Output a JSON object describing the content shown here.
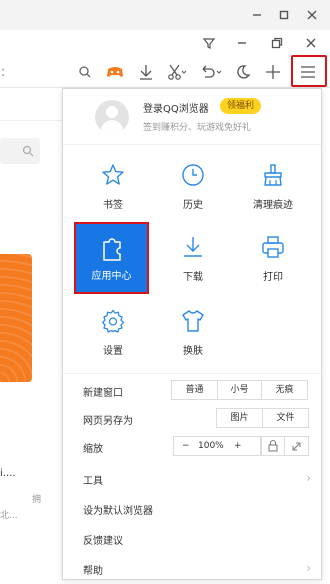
{
  "toolbar": {
    "icons": [
      "search-icon",
      "game-icon",
      "download-icon",
      "scissors-icon",
      "undo-icon",
      "moon-icon",
      "plus-icon",
      "menu-icon"
    ]
  },
  "background": {
    "line1": "i....",
    "line2": "拥",
    "line3": "北..."
  },
  "account": {
    "login": "登录QQ浏览器",
    "welfare": "领福利",
    "subtitle": "签到赚积分、玩游戏免好礼"
  },
  "grid": {
    "bookmarks": "书签",
    "history": "历史",
    "clear_traces": "清理痕迹",
    "app_center": "应用中心",
    "downloads": "下载",
    "print": "打印",
    "settings": "设置",
    "skin": "换肤"
  },
  "new_window": {
    "label": "新建窗口",
    "options": [
      "普通",
      "小号",
      "无痕"
    ]
  },
  "save_page": {
    "label": "网页另存为",
    "options": [
      "图片",
      "文件"
    ]
  },
  "zoom": {
    "label": "缩放",
    "minus": "−",
    "value": "100%",
    "plus": "+"
  },
  "menu": {
    "tools": "工具",
    "set_default": "设为默认浏览器",
    "feedback": "反馈建议",
    "help": "帮助"
  },
  "colors": {
    "accent": "#1877e5",
    "highlight": "#d7141a",
    "welfare": "#ffd21e",
    "banner": "#f47b20"
  }
}
